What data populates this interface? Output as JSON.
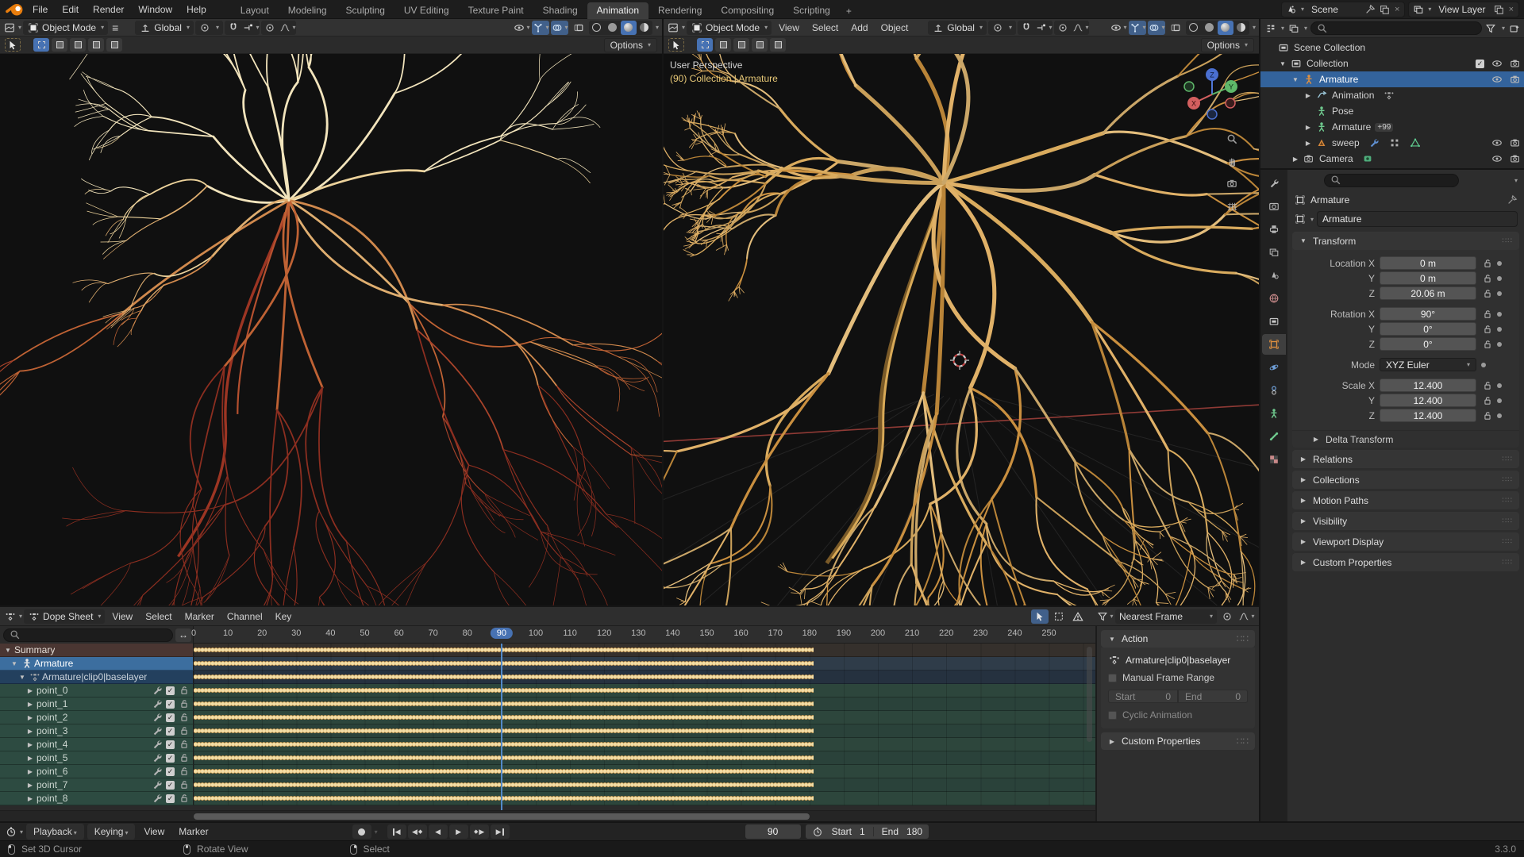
{
  "topbar": {
    "menus": [
      "File",
      "Edit",
      "Render",
      "Window",
      "Help"
    ],
    "workspaces": [
      "Layout",
      "Modeling",
      "Sculpting",
      "UV Editing",
      "Texture Paint",
      "Shading",
      "Animation",
      "Rendering",
      "Compositing",
      "Scripting"
    ],
    "active_workspace": "Animation",
    "new_workspace_label": "+",
    "scene_label": "Scene",
    "view_layer_label": "View Layer"
  },
  "viewports": {
    "left": {
      "mode": "Object Mode",
      "orientation": "Global",
      "options": "Options"
    },
    "right": {
      "mode": "Object Mode",
      "menus": [
        "View",
        "Select",
        "Add",
        "Object"
      ],
      "orientation": "Global",
      "options": "Options",
      "overlay_line1": "User Perspective",
      "overlay_line2": "(90) Collection | Armature",
      "axis_x": "X",
      "axis_y": "Y",
      "axis_z": "Z"
    }
  },
  "outliner": {
    "rows": [
      {
        "label": "Scene Collection",
        "depth": 0,
        "icon": "collection",
        "arrow": "",
        "toggles": []
      },
      {
        "label": "Collection",
        "depth": 1,
        "icon": "collection",
        "arrow": "down",
        "toggles": [
          "checkbox",
          "eye",
          "camera"
        ]
      },
      {
        "label": "Armature",
        "depth": 2,
        "icon": "person-orange",
        "arrow": "down",
        "selected": true,
        "toggles": [
          "eye",
          "camera"
        ]
      },
      {
        "label": "Animation",
        "depth": 3,
        "icon": "anim-arrow",
        "arrow": "right",
        "extras": [
          "keyframes"
        ],
        "toggles": []
      },
      {
        "label": "Pose",
        "depth": 3,
        "icon": "person-green",
        "arrow": "",
        "toggles": []
      },
      {
        "label": "Armature",
        "depth": 3,
        "icon": "person-green",
        "arrow": "right",
        "badge": "+99",
        "toggles": []
      },
      {
        "label": "sweep",
        "depth": 3,
        "icon": "cone",
        "arrow": "right",
        "extras": [
          "wrench-blue",
          "mesh-data",
          "shape-green"
        ],
        "toggles": [
          "eye",
          "camera"
        ]
      },
      {
        "label": "Camera",
        "depth": 2,
        "icon": "camera",
        "arrow": "right",
        "extras": [
          "chip-green"
        ],
        "toggles": [
          "eye",
          "camera"
        ]
      }
    ]
  },
  "properties": {
    "tabs": [
      "tool",
      "render",
      "output",
      "view-layer",
      "scene",
      "world",
      "collection",
      "object",
      "physics",
      "constraints",
      "object-data",
      "bone",
      "texture"
    ],
    "active_tab": "object",
    "breadcrumb": "Armature",
    "object_name": "Armature",
    "transform_title": "Transform",
    "transform_rows": [
      {
        "label": "Location X",
        "value": "0 m",
        "lock": true,
        "gap": false
      },
      {
        "label": "Y",
        "value": "0 m",
        "lock": true,
        "gap": false
      },
      {
        "label": "Z",
        "value": "20.06 m",
        "lock": true,
        "gap": false
      },
      {
        "label": "Rotation X",
        "value": "90°",
        "lock": true,
        "gap": true
      },
      {
        "label": "Y",
        "value": "0°",
        "lock": true,
        "gap": false
      },
      {
        "label": "Z",
        "value": "0°",
        "lock": true,
        "gap": false
      },
      {
        "label": "Mode",
        "value": "XYZ Euler",
        "dropdown": true,
        "gap": true
      },
      {
        "label": "Scale X",
        "value": "12.400",
        "lock": true,
        "gap": true
      },
      {
        "label": "Y",
        "value": "12.400",
        "lock": true,
        "gap": false
      },
      {
        "label": "Z",
        "value": "12.400",
        "lock": true,
        "gap": false
      }
    ],
    "subpanel": "Delta Transform",
    "panels": [
      "Relations",
      "Collections",
      "Motion Paths",
      "Visibility",
      "Viewport Display",
      "Custom Properties"
    ]
  },
  "dopesheet": {
    "editor": "Dope Sheet",
    "menus": [
      "View",
      "Select",
      "Marker",
      "Channel",
      "Key"
    ],
    "snap": "Nearest Frame",
    "ruler": {
      "start": 0,
      "end": 250,
      "step": 10
    },
    "playhead": 90,
    "key_start": 0,
    "key_end": 180,
    "channels": [
      {
        "label": "Summary",
        "type": "summary",
        "arrow": "down",
        "controls": false
      },
      {
        "label": "Armature",
        "type": "object",
        "arrow": "down",
        "controls": false
      },
      {
        "label": "Armature|clip0|baselayer",
        "type": "action",
        "arrow": "down",
        "controls": false
      },
      {
        "label": "point_0",
        "type": "group",
        "arrow": "right",
        "controls": true
      },
      {
        "label": "point_1",
        "type": "group",
        "arrow": "right",
        "controls": true
      },
      {
        "label": "point_2",
        "type": "group",
        "arrow": "right",
        "controls": true
      },
      {
        "label": "point_3",
        "type": "group",
        "arrow": "right",
        "controls": true
      },
      {
        "label": "point_4",
        "type": "group",
        "arrow": "right",
        "controls": true
      },
      {
        "label": "point_5",
        "type": "group",
        "arrow": "right",
        "controls": true
      },
      {
        "label": "point_6",
        "type": "group",
        "arrow": "right",
        "controls": true
      },
      {
        "label": "point_7",
        "type": "group",
        "arrow": "right",
        "controls": true
      },
      {
        "label": "point_8",
        "type": "group",
        "arrow": "right",
        "controls": true
      }
    ],
    "sidebar": {
      "panel_title": "Action",
      "action_name": "Armature|clip0|baselayer",
      "manual_range_label": "Manual Frame Range",
      "start_label": "Start",
      "start_value": "0",
      "end_label": "End",
      "end_value": "0",
      "cyclic_label": "Cyclic Animation",
      "custom_props_label": "Custom Properties"
    }
  },
  "timeline": {
    "menus": [
      "Playback",
      "Keying",
      "View",
      "Marker"
    ],
    "frame": "90",
    "start_label": "Start",
    "start_value": "1",
    "end_label": "End",
    "end_value": "180"
  },
  "statusbar": {
    "hints": [
      "Set 3D Cursor",
      "Rotate View",
      "Select"
    ],
    "version": "3.3.0"
  },
  "colors": {
    "accent": "#4772b3",
    "selection_blue": "#33639c",
    "keyframe": "#f2dda6",
    "keyframe_border": "#cb8f3c",
    "overlay_yellow": "#e7c877",
    "branch_red": "#a8432a",
    "branch_cream": "#f1e2ba",
    "branch_orange": "#dcae63"
  }
}
